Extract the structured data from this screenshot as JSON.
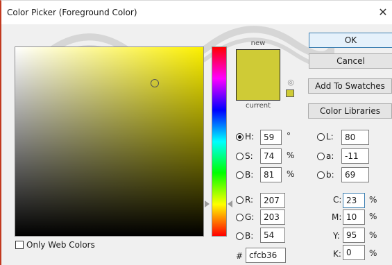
{
  "window": {
    "title": "Color Picker (Foreground Color)",
    "close_glyph": "✕"
  },
  "swatch": {
    "new_label": "new",
    "current_label": "current",
    "new_color": "#cfcb36",
    "current_color": "#cfcb36",
    "gamut_icon": "cube-warning-icon"
  },
  "buttons": {
    "ok": "OK",
    "cancel": "Cancel",
    "add_to_swatches": "Add To Swatches",
    "color_libraries": "Color Libraries"
  },
  "hsb": {
    "h_label": "H:",
    "h": "59",
    "h_unit": "°",
    "s_label": "S:",
    "s": "74",
    "s_unit": "%",
    "b_label": "B:",
    "b": "81",
    "b_unit": "%"
  },
  "rgb": {
    "r_label": "R:",
    "r": "207",
    "g_label": "G:",
    "g": "203",
    "b_label": "B:",
    "b": "54"
  },
  "lab": {
    "l_label": "L:",
    "l": "80",
    "a_label": "a:",
    "a": "-11",
    "b_label": "b:",
    "b": "69"
  },
  "cmyk": {
    "c_label": "C:",
    "c": "23",
    "c_unit": "%",
    "m_label": "M:",
    "m": "10",
    "m_unit": "%",
    "y_label": "Y:",
    "y": "95",
    "y_unit": "%",
    "k_label": "K:",
    "k": "0",
    "k_unit": "%"
  },
  "hex": {
    "label": "#",
    "value": "cfcb36"
  },
  "options": {
    "only_web_colors": "Only Web Colors",
    "only_web_colors_checked": false
  },
  "colors": {
    "field_hue": "#fcf000",
    "accent": "#3c7fb1",
    "window_border": "#c2391f"
  },
  "selected_mode": "H"
}
